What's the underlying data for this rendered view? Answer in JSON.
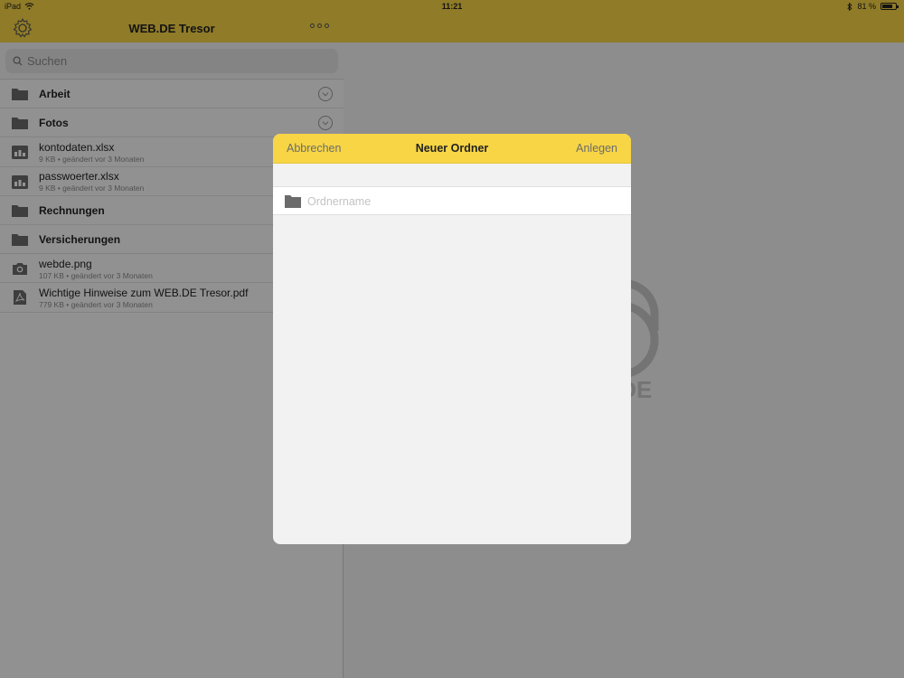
{
  "status": {
    "device": "iPad",
    "time": "11:21",
    "battery": "81 %",
    "battery_level": 0.81
  },
  "app": {
    "title": "WEB.DE Tresor"
  },
  "search": {
    "placeholder": "Suchen"
  },
  "files": [
    {
      "name": "Arbeit",
      "type": "folder",
      "meta": ""
    },
    {
      "name": "Fotos",
      "type": "folder",
      "meta": ""
    },
    {
      "name": "kontodaten.xlsx",
      "type": "spreadsheet",
      "meta": "9 KB • geändert vor 3 Monaten"
    },
    {
      "name": "passwoerter.xlsx",
      "type": "spreadsheet",
      "meta": "9 KB • geändert vor 3 Monaten"
    },
    {
      "name": "Rechnungen",
      "type": "folder",
      "meta": ""
    },
    {
      "name": "Versicherungen",
      "type": "folder",
      "meta": ""
    },
    {
      "name": "webde.png",
      "type": "image",
      "meta": "107 KB • geändert vor 3 Monaten"
    },
    {
      "name": "Wichtige Hinweise zum WEB.DE Tresor.pdf",
      "type": "pdf",
      "meta": "779 KB • geändert vor 3 Monaten"
    }
  ],
  "watermark": {
    "text": ".DE"
  },
  "modal": {
    "cancel_label": "Abbrechen",
    "title": "Neuer Ordner",
    "create_label": "Anlegen",
    "name_placeholder": "Ordnername",
    "name_value": ""
  },
  "colors": {
    "accent": "#f7d545",
    "icon_gray": "#6b6b6b"
  }
}
